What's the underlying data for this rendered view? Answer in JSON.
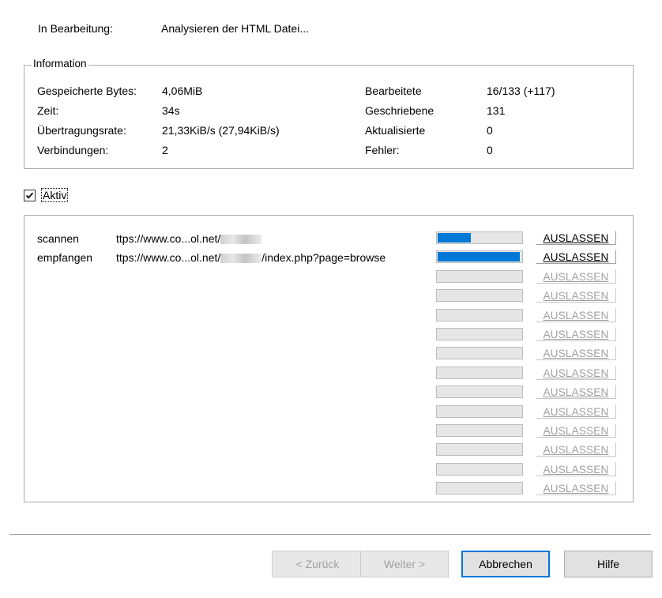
{
  "status": {
    "label": "In Bearbeitung:",
    "value": "Analysieren der HTML Datei..."
  },
  "information": {
    "legend": "Information",
    "left": [
      {
        "label": "Gespeicherte Bytes:",
        "value": "4,06MiB"
      },
      {
        "label": "Zeit:",
        "value": "34s"
      },
      {
        "label": "Übertragungsrate:",
        "value": "21,33KiB/s (27,94KiB/s)"
      },
      {
        "label": "Verbindungen:",
        "value": "2"
      }
    ],
    "right": [
      {
        "label": "Bearbeitete",
        "value": "16/133 (+117)"
      },
      {
        "label": "Geschriebene",
        "value": "131"
      },
      {
        "label": "Aktualisierte",
        "value": "0"
      },
      {
        "label": "Fehler:",
        "value": "0"
      }
    ]
  },
  "active": {
    "label": "Aktiv",
    "checked": true
  },
  "transfers": {
    "rows": [
      {
        "action": "scannen",
        "url_prefix": "ttps://www.co...ol.net/",
        "url_suffix": "",
        "progress": 0.4
      },
      {
        "action": "empfangen",
        "url_prefix": "ttps://www.co...ol.net/",
        "url_suffix": "/index.php?page=browse",
        "progress": 0.98
      }
    ],
    "slot_count": 14,
    "skip_label": "AUSLASSEN"
  },
  "buttons": {
    "back": "< Zurück",
    "next": "Weiter >",
    "cancel": "Abbrechen",
    "help": "Hilfe"
  },
  "colors": {
    "progress_fill": "#0078d7",
    "default_button_border": "#0078d7"
  }
}
